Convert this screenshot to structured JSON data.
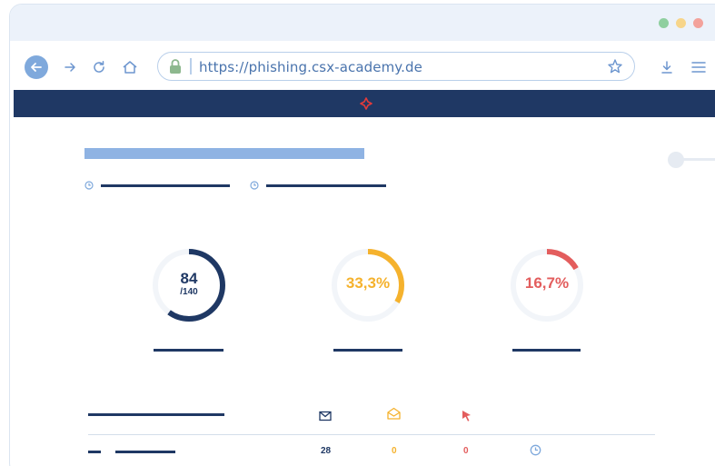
{
  "window": {
    "controls": [
      {
        "name": "maximize",
        "color": "#8fcf9f"
      },
      {
        "name": "minimize",
        "color": "#f7d58a"
      },
      {
        "name": "close",
        "color": "#f3a29b"
      }
    ]
  },
  "toolbar": {
    "back_icon": "arrow-left-icon",
    "forward_icon": "arrow-right-icon",
    "reload_icon": "reload-icon",
    "home_icon": "home-icon",
    "download_icon": "download-icon",
    "menu_icon": "hamburger-menu-icon"
  },
  "address_bar": {
    "url": "https://phishing.csx-academy.de",
    "lock_icon": "lock-icon",
    "bookmark_icon": "star-icon"
  },
  "site_nav": {
    "background": "#1f3864",
    "logo_color": "#e23b3b"
  },
  "stats": [
    {
      "id": "sent",
      "value": "84",
      "total": "/140",
      "fraction": 0.6,
      "color": "#1f3864"
    },
    {
      "id": "opened",
      "value": "33,3%",
      "fraction": 0.333,
      "color": "#f5b22d"
    },
    {
      "id": "clicked",
      "value": "16,7%",
      "fraction": 0.167,
      "color": "#e35d5d"
    }
  ],
  "table": {
    "header_icons": [
      "mail-icon",
      "mail-open-icon",
      "cursor-click-icon"
    ],
    "rows": [
      {
        "sent": "28",
        "opened": "0",
        "clicked": "0",
        "status_icon": "clock-icon"
      }
    ]
  },
  "colors": {
    "accent": "#1f3864",
    "highlight": "#8fb3e3",
    "warning": "#f5b22d",
    "danger": "#e35d5d"
  }
}
